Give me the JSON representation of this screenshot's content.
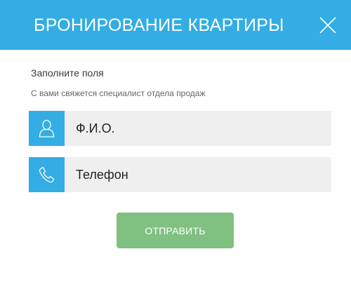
{
  "modal": {
    "title": "БРОНИРОВАНИЕ КВАРТИРЫ",
    "close_icon": "close-icon",
    "colors": {
      "header_background": "#33ade3",
      "icon_background": "#33ade3",
      "field_background": "#efefef",
      "submit_background": "#80c081"
    }
  },
  "form": {
    "heading": "Заполните поля",
    "subtext": "С вами свяжется специалист отдела продаж",
    "fields": [
      {
        "icon": "user-icon",
        "placeholder": "Ф.И.О.",
        "value": ""
      },
      {
        "icon": "phone-icon",
        "placeholder": "Телефон",
        "value": ""
      }
    ],
    "submit_label": "ОТПРАВИТЬ"
  }
}
